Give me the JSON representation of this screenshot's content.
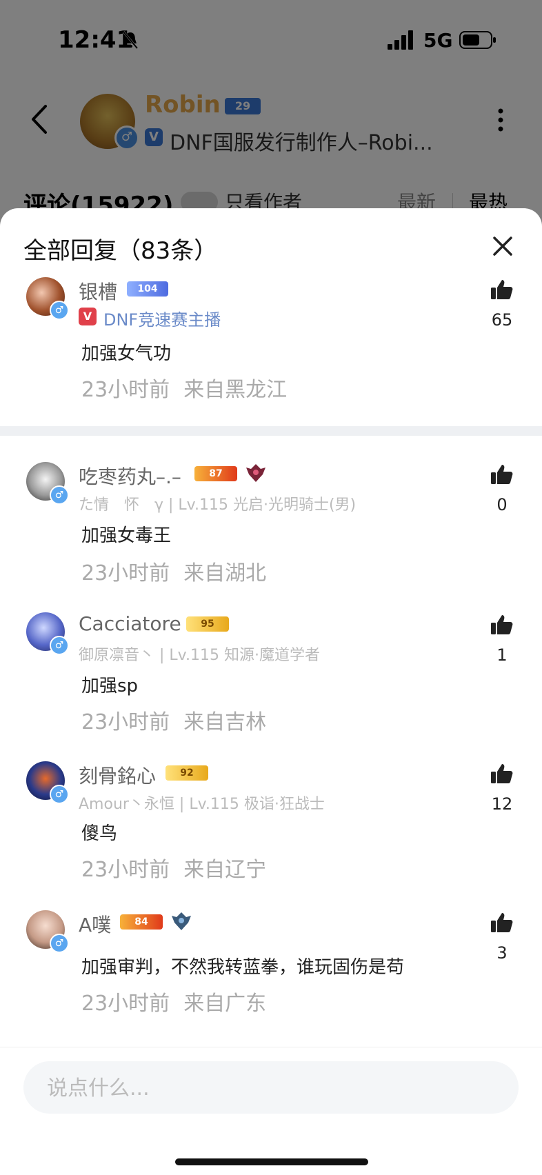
{
  "status_bar": {
    "time": "12:41",
    "network": "5G",
    "icons": [
      "bell-muted-icon",
      "signal-icon",
      "battery-icon"
    ]
  },
  "header": {
    "back_icon": "chevron-left-icon",
    "author_name": "Robin",
    "author_level": "29",
    "verify_mark": "V",
    "author_title": "DNF国服发行制作人–Robi...",
    "more_icon": "vertical-dots-icon"
  },
  "comments_bar": {
    "label": "评论(15922)",
    "author_only_label": "只看作者",
    "sort_newest": "最新",
    "sort_hot": "最热"
  },
  "sheet": {
    "title": "全部回复（83条）",
    "close_icon": "close-icon",
    "gender_mark": "♂",
    "replies": [
      {
        "username": "银槽",
        "level": "104",
        "verify_mark": "V",
        "title": "DNF竞速赛主播",
        "text": "加强女气功",
        "time": "23小时前",
        "location": "来自黑龙江",
        "likes": "65"
      },
      {
        "username": "吃枣药丸–.–",
        "level": "87",
        "subline": "た情　怀　γ | Lv.115 光启·光明骑士(男)",
        "text": "加强女毒王",
        "time": "23小时前",
        "location": "来自湖北",
        "likes": "0"
      },
      {
        "username": "Cacciatore",
        "level": "95",
        "subline": "御原凛音丶 | Lv.115 知源·魔道学者",
        "text": "加强sp",
        "time": "23小时前",
        "location": "来自吉林",
        "likes": "1"
      },
      {
        "username": "刻骨銘心",
        "level": "92",
        "subline": "Amour丶永恒 | Lv.115 极诣·狂战士",
        "text": "傻鸟",
        "time": "23小时前",
        "location": "来自辽宁",
        "likes": "12"
      },
      {
        "username": "A噗",
        "level": "84",
        "text": "加强审判，不然我转蓝拳，谁玩固伤是苟",
        "time": "23小时前",
        "location": "来自广东",
        "likes": "3"
      }
    ]
  },
  "input": {
    "placeholder": "说点什么..."
  },
  "colors": {
    "author_name": "#e6a84a",
    "link_blue": "#6a8ac8",
    "gender_badge": "#5aa6f0",
    "overlay": "rgba(0,0,0,0.5)"
  }
}
